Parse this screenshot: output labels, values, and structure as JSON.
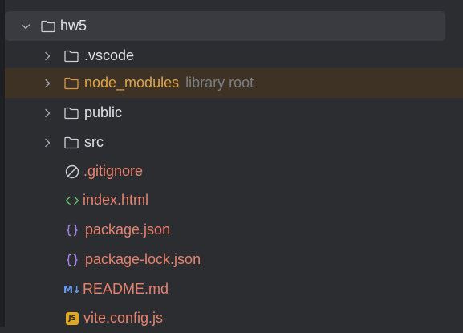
{
  "tree": {
    "root": {
      "label": "hw5",
      "expanded": true,
      "icon": "folder-icon"
    },
    "folders": [
      {
        "label": ".vscode",
        "icon": "folder-icon"
      },
      {
        "label": "node_modules",
        "hint": "library root",
        "icon": "folder-icon"
      },
      {
        "label": "public",
        "icon": "folder-icon"
      },
      {
        "label": "src",
        "icon": "folder-icon"
      }
    ],
    "files": [
      {
        "label": ".gitignore",
        "icon": "gitignore-icon"
      },
      {
        "label": "index.html",
        "icon": "html-icon"
      },
      {
        "label": "package.json",
        "icon": "json-icon"
      },
      {
        "label": "package-lock.json",
        "icon": "json-icon"
      },
      {
        "label": "README.md",
        "icon": "markdown-icon",
        "badge": "M↓"
      },
      {
        "label": "vite.config.js",
        "icon": "javascript-icon",
        "badge": "JS"
      }
    ]
  },
  "colors": {
    "background": "#2b2d30",
    "selected_row": "#393b40",
    "excluded_row": "#3d3223",
    "modified_text": "#e8826e",
    "library_text": "#e0a24c",
    "hint_text": "#7a7e85"
  }
}
